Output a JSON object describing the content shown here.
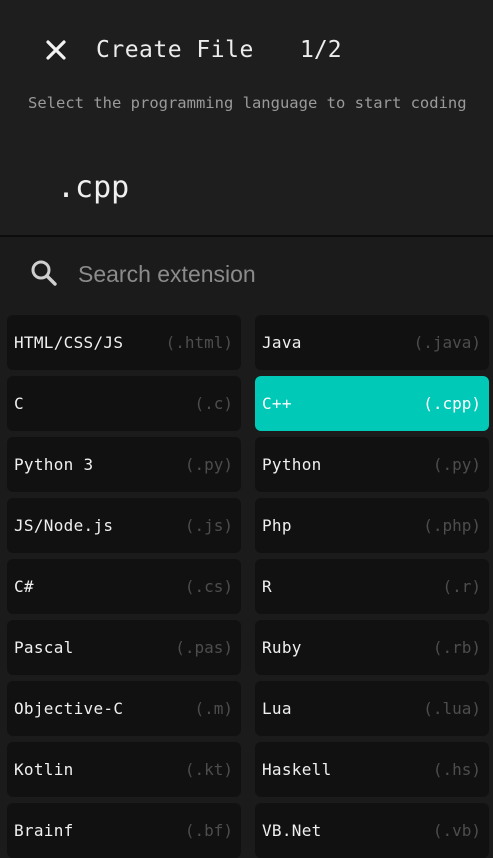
{
  "header": {
    "title": "Create File",
    "step": "1/2",
    "subtitle": "Select the programming language to start coding",
    "selected_extension": ".cpp"
  },
  "search": {
    "placeholder": "Search extension",
    "value": ""
  },
  "colors": {
    "accent": "#00c9b7",
    "background": "#1b1b1b",
    "tile": "#111111"
  },
  "languages": [
    {
      "name": "HTML/CSS/JS",
      "ext": "(.html)",
      "selected": false
    },
    {
      "name": "Java",
      "ext": "(.java)",
      "selected": false
    },
    {
      "name": "C",
      "ext": "(.c)",
      "selected": false
    },
    {
      "name": "C++",
      "ext": "(.cpp)",
      "selected": true
    },
    {
      "name": "Python 3",
      "ext": "(.py)",
      "selected": false
    },
    {
      "name": "Python",
      "ext": "(.py)",
      "selected": false
    },
    {
      "name": "JS/Node.js",
      "ext": "(.js)",
      "selected": false
    },
    {
      "name": "Php",
      "ext": "(.php)",
      "selected": false
    },
    {
      "name": "C#",
      "ext": "(.cs)",
      "selected": false
    },
    {
      "name": "R",
      "ext": "(.r)",
      "selected": false
    },
    {
      "name": "Pascal",
      "ext": "(.pas)",
      "selected": false
    },
    {
      "name": "Ruby",
      "ext": "(.rb)",
      "selected": false
    },
    {
      "name": "Objective-C",
      "ext": "(.m)",
      "selected": false
    },
    {
      "name": "Lua",
      "ext": "(.lua)",
      "selected": false
    },
    {
      "name": "Kotlin",
      "ext": "(.kt)",
      "selected": false
    },
    {
      "name": "Haskell",
      "ext": "(.hs)",
      "selected": false
    },
    {
      "name": "Brainf",
      "ext": "(.bf)",
      "selected": false
    },
    {
      "name": "VB.Net",
      "ext": "(.vb)",
      "selected": false
    }
  ]
}
